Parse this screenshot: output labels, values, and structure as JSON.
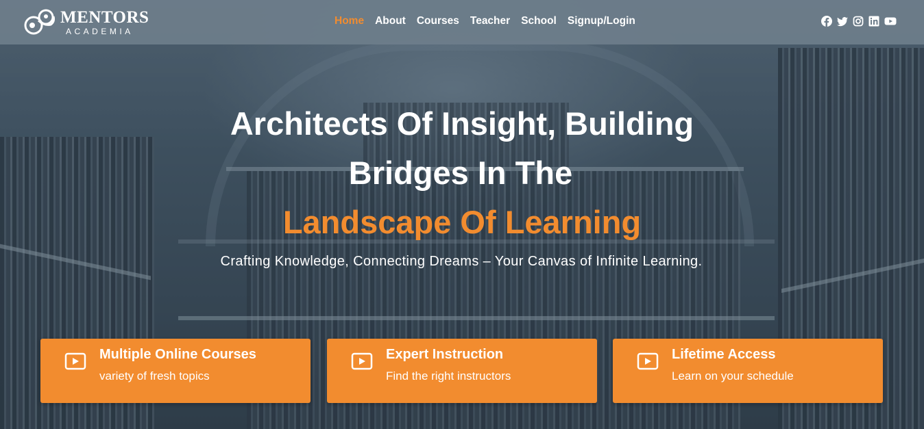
{
  "brand": {
    "name": "MENTORS",
    "tagline": "ACADEMIA"
  },
  "nav": {
    "items": [
      {
        "label": "Home",
        "active": true
      },
      {
        "label": "About",
        "active": false
      },
      {
        "label": "Courses",
        "active": false
      },
      {
        "label": "Teacher",
        "active": false
      },
      {
        "label": "School",
        "active": false
      },
      {
        "label": "Signup/Login",
        "active": false
      }
    ]
  },
  "social": [
    "facebook-icon",
    "twitter-icon",
    "instagram-icon",
    "linkedin-icon",
    "youtube-icon"
  ],
  "hero": {
    "title_line1": "Architects Of Insight, Building",
    "title_line2": "Bridges In The",
    "title_line3": "Landscape Of Learning",
    "subtitle": "Crafting Knowledge, Connecting Dreams – Your Canvas of Infinite Learning."
  },
  "features": [
    {
      "title": "Multiple Online Courses",
      "desc": "variety of fresh topics",
      "icon": "play-icon"
    },
    {
      "title": "Expert Instruction",
      "desc": "Find the right instructors",
      "icon": "play-icon"
    },
    {
      "title": "Lifetime Access",
      "desc": "Learn on your schedule",
      "icon": "play-icon"
    }
  ],
  "colors": {
    "accent": "#f28c2f",
    "header_bg": "#6e7e8b",
    "text": "#ffffff"
  }
}
